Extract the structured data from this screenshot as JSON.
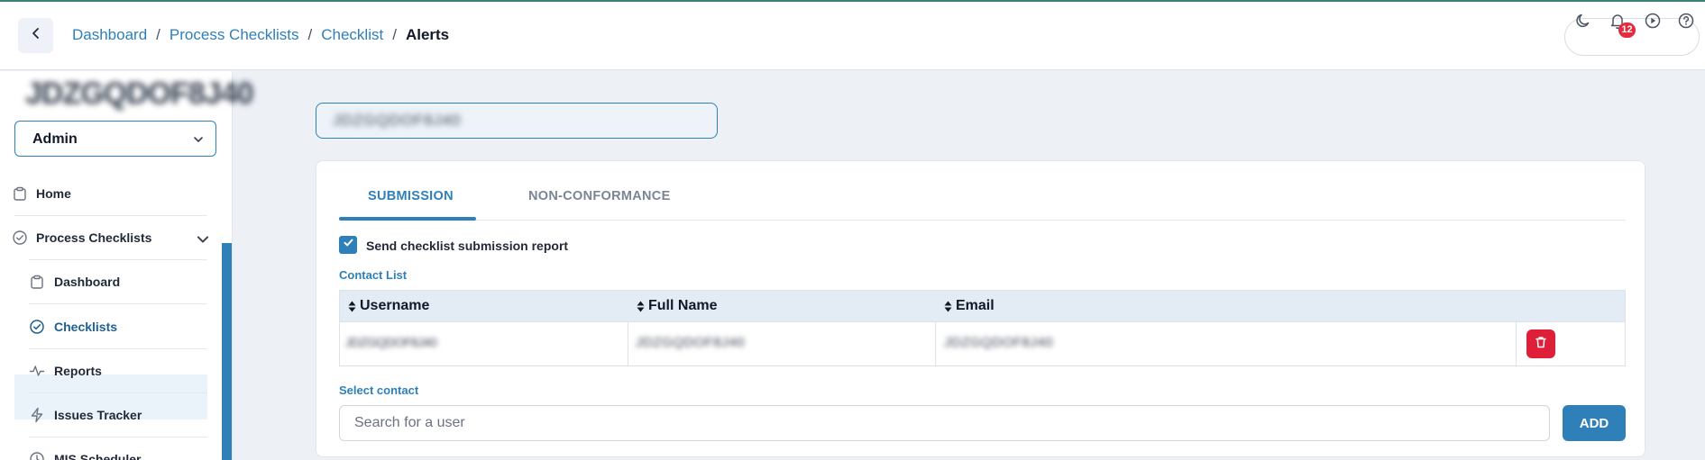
{
  "header": {
    "breadcrumb": [
      "Dashboard",
      "Process Checklists",
      "Checklist"
    ],
    "current_page": "Alerts",
    "notification_count": "12",
    "icons": [
      "chevron-left-icon",
      "moon-icon",
      "bell-icon",
      "play-circle-icon",
      "help-circle-icon"
    ]
  },
  "sidebar": {
    "org_name": "JDZGQDOF8J40",
    "role": "Admin",
    "items": [
      {
        "label": "Home",
        "icon": "clipboard-icon"
      },
      {
        "label": "Process Checklists",
        "icon": "check-circle-icon"
      },
      {
        "label": "Dashboard",
        "icon": "clipboard-icon"
      },
      {
        "label": "Checklists",
        "icon": "check-circle-icon"
      },
      {
        "label": "Reports",
        "icon": "activity-icon"
      },
      {
        "label": "Issues Tracker",
        "icon": "zap-icon"
      },
      {
        "label": "MIS Scheduler",
        "icon": "clock-icon"
      }
    ]
  },
  "main": {
    "checklist_title": "JDZGQDOF8J40",
    "tabs": [
      "SUBMISSION",
      "NON-CONFORMANCE"
    ],
    "active_tab": "SUBMISSION",
    "send_report_label": "Send checklist submission report",
    "send_report_checked": true,
    "contact_list_label": "Contact List",
    "table": {
      "columns": [
        "Username",
        "Full Name",
        "Email"
      ],
      "rows": [
        {
          "username": "JDZGQDOF8J40",
          "full_name": "JDZGQDOF8J40",
          "email": "JDZGQDOF8J40"
        }
      ]
    },
    "select_contact_label": "Select contact",
    "search_placeholder": "Search for a user",
    "add_label": "ADD"
  },
  "colors": {
    "accent": "#2f7fb8",
    "danger": "#df1f3a",
    "badge": "#e5293e",
    "top_line": "#3d7f78"
  }
}
